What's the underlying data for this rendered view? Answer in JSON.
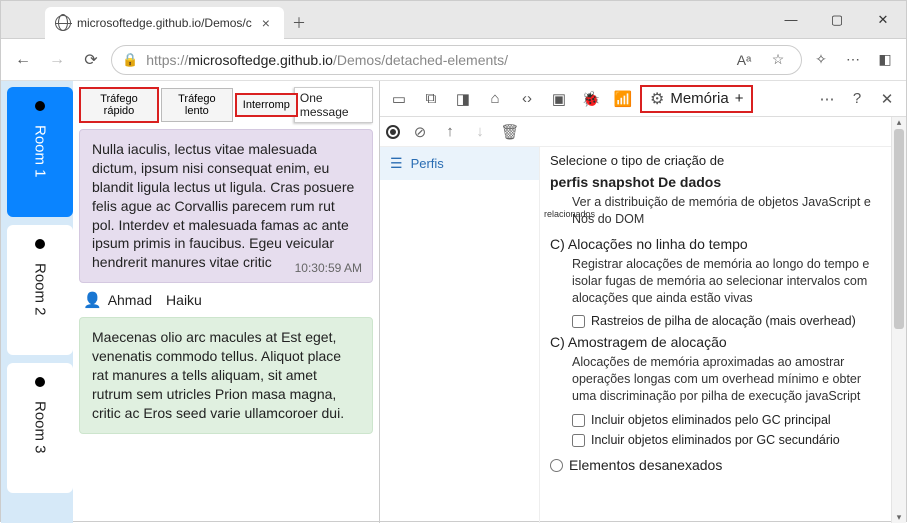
{
  "window": {
    "tab_title": "microsoftedge.github.io/Demos/c",
    "url_prefix": "https://",
    "url_host": "microsoftedge.github.io",
    "url_path": "/Demos/detached-elements/",
    "reading_mode": "Aᵃ"
  },
  "rooms": [
    {
      "label": "Room 1",
      "active": true
    },
    {
      "label": "Room 2",
      "active": false
    },
    {
      "label": "Room 3",
      "active": false
    }
  ],
  "chat_tabs": {
    "fast": "Tráfego rápido",
    "slow": "Tráfego lento",
    "interrupt": "Interromp",
    "one_msg": "One message"
  },
  "messages": [
    {
      "body": "Nulla iaculis, lectus vitae malesuada dictum, ipsum nisi consequat enim, eu blandit ligula lectus ut ligula. Cras posuere felis ague ac Corvallis parecem rum rut pol. Interdev et malesuada famas ac ante ipsum primis in faucibus. Egeu veicular hendrerit manures vitae critic",
      "time": "10:30:59 AM"
    },
    {
      "author": "Ahmad",
      "haiku": "Haiku",
      "body": "Maecenas olio arc macules at Est eget, venenatis commodo tellus. Aliquot place rat manures a tells aliquam, sit amet rutrum sem utricles  Prion masa magna, critic ac Eros seed varie ullamcoroer dui."
    }
  ],
  "devtools": {
    "mem_label": "Memória",
    "profiles": "Perfis",
    "snapshot_title_1": "Selecione o tipo de criação de",
    "snapshot_title_2": "perfis snapshot De dados",
    "snapshot_desc": "Ver a distribuição de memória de objetos JavaScript e Nós do DOM",
    "related": "relacionados",
    "alloc_timeline_title": "C) Alocações no linha do tempo",
    "alloc_timeline_desc": "Registrar alocações de memória ao longo do tempo e isolar fugas de memória ao selecionar intervalos com alocações que ainda estão vivas",
    "stack_traces": "Rastreios de pilha de alocação (mais overhead)",
    "alloc_sampling_title": "C) Amostragem de alocação",
    "alloc_sampling_desc": "Alocações de memória aproximadas ao amostrar operações longas com um overhead mínimo e obter uma discriminação por pilha de execução javaScript",
    "include_gc_major": "Incluir objetos eliminados pelo GC principal",
    "include_gc_minor": "Incluir objetos eliminados por GC secundário",
    "detached_elements": "Elementos desanexados"
  }
}
